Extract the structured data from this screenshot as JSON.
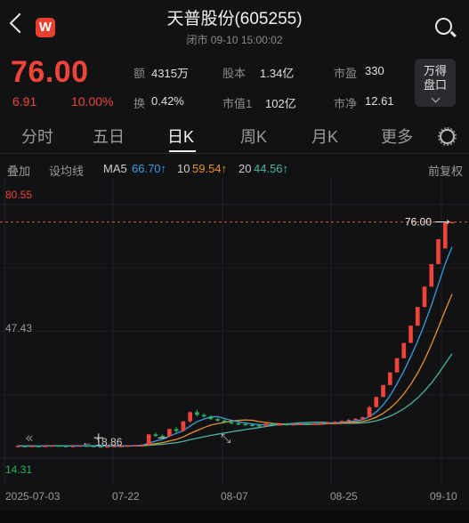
{
  "header": {
    "app_logo": "W",
    "title": "天普股份(605255)",
    "subtitle": "闭市  09-10 15:00:02"
  },
  "quote": {
    "price": "76.00",
    "change": "6.91",
    "change_pct": "10.00%",
    "stats": {
      "amount_label": "额",
      "amount": "4315万",
      "share_label": "股本",
      "share": "1.34亿",
      "pe_label": "市盈",
      "pe": "330",
      "turnover_label": "换",
      "turnover": "0.42%",
      "mcap_label": "市值1",
      "mcap": "102亿",
      "pb_label": "市净",
      "pb": "12.61"
    },
    "wanpan_line1": "万得",
    "wanpan_line2": "盘口"
  },
  "tabs": [
    "分时",
    "五日",
    "日K",
    "周K",
    "月K",
    "更多"
  ],
  "active_tab": 2,
  "indicators": {
    "overlay": "叠加",
    "draw": "设均线",
    "ma5_label": "MA5",
    "ma5": "66.70↑",
    "ma10_label": "10",
    "ma10": "59.54↑",
    "ma20_label": "20",
    "ma20": "44.56↑",
    "restore": "前复权"
  },
  "chart_data": {
    "type": "candlestick",
    "y_axis_labels": [
      "80.55",
      "47.43",
      "14.31"
    ],
    "price_marker": "76.00",
    "low_marker": "18.86",
    "ylim": [
      14.31,
      80.55
    ],
    "x_labels": [
      "2025-07-03",
      "07-22",
      "08-07",
      "08-25",
      "09-10"
    ],
    "candles": [
      [
        17.4,
        17.6,
        17.2,
        17.5
      ],
      [
        17.5,
        17.7,
        17.3,
        17.4
      ],
      [
        17.4,
        17.6,
        17.2,
        17.5
      ],
      [
        17.5,
        17.6,
        17.3,
        17.4
      ],
      [
        17.4,
        17.6,
        17.2,
        17.5
      ],
      [
        17.5,
        17.7,
        17.4,
        17.6
      ],
      [
        17.6,
        17.7,
        17.4,
        17.5
      ],
      [
        17.5,
        17.6,
        17.3,
        17.4
      ],
      [
        17.4,
        17.6,
        17.2,
        17.5
      ],
      [
        17.5,
        17.6,
        17.3,
        17.6
      ],
      [
        17.6,
        17.7,
        17.4,
        17.5
      ],
      [
        17.5,
        17.6,
        17.3,
        17.4
      ],
      [
        17.4,
        17.5,
        17.2,
        17.3
      ],
      [
        17.3,
        17.5,
        17.1,
        17.4
      ],
      [
        17.4,
        17.6,
        17.2,
        17.5
      ],
      [
        17.5,
        17.6,
        17.3,
        17.5
      ],
      [
        17.5,
        17.7,
        17.3,
        17.6
      ],
      [
        17.6,
        17.8,
        17.4,
        17.7
      ],
      [
        17.7,
        17.9,
        17.5,
        17.8
      ],
      [
        17.8,
        20.6,
        17.6,
        20.5
      ],
      [
        20.5,
        21.0,
        19.8,
        20.1
      ],
      [
        20.1,
        20.5,
        19.6,
        20.0
      ],
      [
        20.0,
        22.0,
        19.8,
        21.9
      ],
      [
        21.9,
        22.4,
        21.0,
        21.4
      ],
      [
        21.4,
        24.0,
        21.2,
        23.9
      ],
      [
        23.9,
        26.5,
        23.5,
        26.3
      ],
      [
        26.3,
        27.0,
        25.2,
        25.6
      ],
      [
        25.6,
        26.0,
        24.8,
        25.2
      ],
      [
        25.2,
        25.5,
        24.3,
        24.5
      ],
      [
        24.5,
        24.9,
        23.8,
        24.1
      ],
      [
        24.1,
        24.4,
        23.4,
        23.7
      ],
      [
        23.7,
        24.0,
        23.1,
        23.4
      ],
      [
        23.4,
        23.6,
        22.9,
        23.2
      ],
      [
        23.2,
        23.5,
        22.8,
        23.0
      ],
      [
        23.0,
        23.3,
        22.6,
        22.9
      ],
      [
        22.9,
        23.2,
        22.5,
        22.7
      ],
      [
        22.7,
        23.5,
        22.5,
        23.3
      ],
      [
        23.3,
        23.6,
        22.8,
        23.0
      ],
      [
        23.0,
        23.4,
        22.7,
        23.2
      ],
      [
        23.2,
        23.5,
        22.9,
        23.1
      ],
      [
        23.1,
        23.4,
        22.8,
        23.2
      ],
      [
        23.2,
        23.5,
        22.9,
        23.3
      ],
      [
        23.3,
        23.6,
        23.0,
        23.2
      ],
      [
        23.2,
        23.5,
        22.9,
        23.4
      ],
      [
        23.4,
        23.7,
        23.1,
        23.5
      ],
      [
        23.5,
        23.8,
        23.2,
        23.6
      ],
      [
        23.6,
        23.9,
        23.3,
        23.8
      ],
      [
        23.8,
        24.2,
        23.5,
        24.0
      ],
      [
        24.0,
        24.5,
        23.8,
        24.3
      ],
      [
        24.3,
        24.7,
        24.0,
        24.6
      ],
      [
        24.6,
        25.1,
        24.4,
        25.0
      ],
      [
        25.0,
        28.0,
        25.0,
        27.6
      ],
      [
        27.6,
        30.3,
        27.6,
        30.3
      ],
      [
        30.3,
        33.4,
        30.3,
        33.4
      ],
      [
        33.4,
        36.7,
        33.4,
        36.7
      ],
      [
        36.7,
        40.4,
        36.7,
        40.4
      ],
      [
        40.4,
        44.4,
        40.4,
        44.4
      ],
      [
        44.4,
        48.9,
        44.4,
        48.9
      ],
      [
        48.9,
        53.8,
        48.9,
        53.8
      ],
      [
        53.8,
        59.1,
        53.8,
        59.1
      ],
      [
        59.1,
        65.0,
        59.1,
        65.0
      ],
      [
        65.0,
        71.5,
        65.0,
        71.5
      ],
      [
        69.09,
        76.0,
        69.09,
        76.0
      ],
      [
        76.0,
        76.0,
        76.0,
        76.0
      ]
    ],
    "ma_colors": {
      "ma5": "#3a9ee0",
      "ma10": "#e8912a",
      "ma20": "#4cb3a0"
    },
    "up_color": "#f0443a",
    "down_color": "#2db35e"
  }
}
